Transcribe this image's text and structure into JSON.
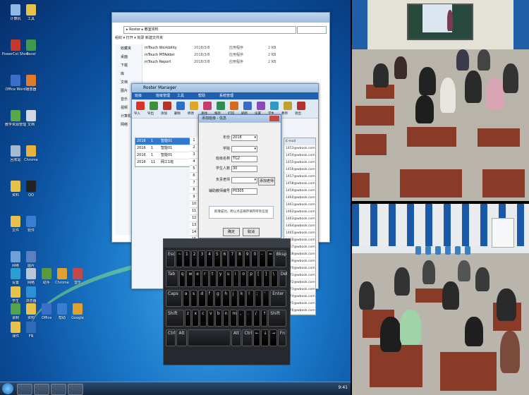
{
  "desktop": {
    "icons": [
      {
        "label": "计算机",
        "color": "#8fb8e6"
      },
      {
        "label": "PowerCol Show",
        "color": "#c0392b"
      },
      {
        "label": "Office Word",
        "color": "#3b6fc9"
      },
      {
        "label": "教学资源管理",
        "color": "#5aa64a"
      },
      {
        "label": "回收站",
        "color": "#a7b9cf"
      },
      {
        "label": "资料",
        "color": "#e6c24a"
      },
      {
        "label": "文件",
        "color": "#e6c24a"
      },
      {
        "label": "网络",
        "color": "#6fa0d8"
      },
      {
        "label": "学生",
        "color": "#e6c24a"
      },
      {
        "label": "课件",
        "color": "#e6c24a"
      },
      {
        "label": "工具",
        "color": "#e6c24a"
      },
      {
        "label": "Excel",
        "color": "#3d9a4a"
      },
      {
        "label": "播放器",
        "color": "#e07b2a"
      },
      {
        "label": "文档",
        "color": "#cfd8e3"
      },
      {
        "label": "Chrome",
        "color": "#e8b33c"
      },
      {
        "label": "QQ",
        "color": "#222222"
      },
      {
        "label": "软件",
        "color": "#3a7ed1"
      },
      {
        "label": "图片",
        "color": "#5c7fc4"
      },
      {
        "label": "浏览器",
        "color": "#2d8fd6"
      },
      {
        "label": "FN",
        "color": "#2e6bb8"
      },
      {
        "label": "设置",
        "color": "#2a9fd0"
      },
      {
        "label": "网络",
        "color": "#b8c7d8"
      },
      {
        "label": "助手",
        "color": "#5a9a3d"
      },
      {
        "label": "Chrome",
        "color": "#e0a030"
      },
      {
        "label": "音乐",
        "color": "#c04a4a"
      },
      {
        "label": "录制",
        "color": "#56a34d"
      },
      {
        "label": "资料",
        "color": "#e6c24a"
      },
      {
        "label": "Office",
        "color": "#3b6fc9"
      },
      {
        "label": "帮助",
        "color": "#3a7ed1"
      },
      {
        "label": "Google",
        "color": "#e0a030"
      }
    ],
    "taskbar": {
      "clock": "9:41"
    }
  },
  "explorer": {
    "address": "▸ Roster ▸ 教室资料",
    "menu": "组织 ▾   打开 ▾   刻录   新建文件夹",
    "nav": [
      "收藏夹",
      "桌面",
      "下载",
      "库",
      "文档",
      "图片",
      "音乐",
      "视频",
      "计算机",
      "网络"
    ],
    "files": [
      {
        "name": "mTouch Workbility",
        "date": "2018/3/8",
        "type": "应用程序",
        "size": "2 KB"
      },
      {
        "name": "mTouch MTAdder",
        "date": "2018/3/8",
        "type": "应用程序",
        "size": "2 KB"
      },
      {
        "name": "mTouch Report",
        "date": "2018/3/8",
        "type": "应用程序",
        "size": "2 KB"
      }
    ]
  },
  "roster": {
    "title": "Roster Manager",
    "tabs": [
      "班级",
      "班级管理",
      "工具",
      "帮助",
      "系统管理"
    ],
    "tools": [
      "导入",
      "导出",
      "添加",
      "删除",
      "修改",
      "查找",
      "保存",
      "打印",
      "刷新",
      "设置",
      "学生",
      "教师",
      "退出"
    ],
    "grid": [
      {
        "a": "2016",
        "b": "1",
        "c": "智能01"
      },
      {
        "a": "2016",
        "b": "1",
        "c": "智能01"
      },
      {
        "a": "2016",
        "b": "1",
        "c": "智能01"
      },
      {
        "a": "2016",
        "b": "11",
        "c": "网工1班"
      }
    ],
    "rownums": [
      "1",
      "2",
      "3",
      "4",
      "5",
      "6",
      "7",
      "8",
      "9",
      "10",
      "11",
      "12",
      "13",
      "14",
      "15",
      "16",
      "17",
      "18",
      "19",
      "20",
      "21",
      "22",
      "23",
      "24"
    ],
    "emailhdr": "E-mail",
    "emails": [
      "1453@wbook.com.cn",
      "1454@wbook.com.cn",
      "1455@wbook.com.cn",
      "1456@wbook.com.cn",
      "1457@wbook.com.cn",
      "1458@wbook.com.cn",
      "1459@wbook.com.cn",
      "1460@wbook.com.cn",
      "1461@wbook.com.cn",
      "1462@wbook.com.cn",
      "1463@wbook.com.cn",
      "1464@wbook.com.cn",
      "1465@wbook.com.cn",
      "1466@wbook.com.cn",
      "1467@wbook.com.cn",
      "1468@wbook.com.cn",
      "1469@wbook.com.cn",
      "1470@wbook.com.cn",
      "1471@wbook.com.cn",
      "1472@wbook.com.cn",
      "1473@wbook.com.cn",
      "1474@wbook.com.cn",
      "1475@wbook.com.cn",
      "1476@wbook.com.cn"
    ]
  },
  "dialog": {
    "title": "添加班级 - 信息",
    "fields": [
      {
        "label": "年份",
        "value": "2018"
      },
      {
        "label": "学院",
        "value": ""
      },
      {
        "label": "班级名称",
        "value": "TG2"
      },
      {
        "label": "学生人数",
        "value": "30"
      },
      {
        "label": "负责老师",
        "value": ""
      },
      {
        "label": "辅助教师编号",
        "value": "P0305"
      }
    ],
    "side_btn": "添加老师",
    "msg": "新增成功，所以点击保存保存所有信息",
    "ok": "确定",
    "cancel": "取消"
  },
  "keyboard": {
    "rows": [
      [
        "Esc",
        "~",
        "1",
        "2",
        "3",
        "4",
        "5",
        "6",
        "7",
        "8",
        "9",
        "0",
        "-",
        "=",
        "Bksp"
      ],
      [
        "Tab",
        "q",
        "w",
        "e",
        "r",
        "t",
        "y",
        "u",
        "i",
        "o",
        "p",
        "[",
        "]",
        "\\",
        "Del"
      ],
      [
        "Caps",
        "a",
        "s",
        "d",
        "f",
        "g",
        "h",
        "j",
        "k",
        "l",
        ";",
        "'",
        "Enter"
      ],
      [
        "Shift",
        "z",
        "x",
        "c",
        "v",
        "b",
        "n",
        "m",
        ",",
        ".",
        "/",
        "↑",
        "Shift"
      ],
      [
        "Ctrl",
        "Alt",
        "",
        "Alt",
        "Ctrl",
        "←",
        "↓",
        "→",
        "Fn"
      ]
    ]
  },
  "colors": {
    "accent": "#1f5fb0",
    "desk": "#8a3b28",
    "chair": "#3a7fc0"
  }
}
